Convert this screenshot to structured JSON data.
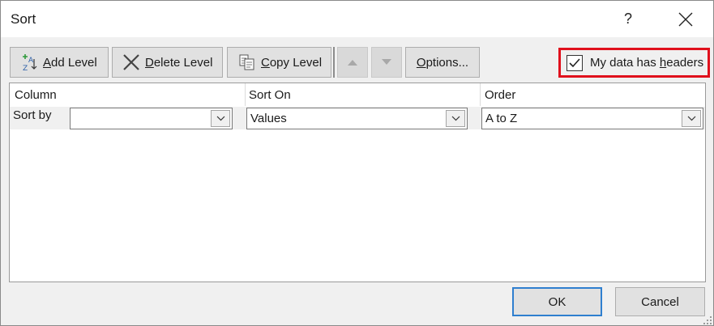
{
  "dialog": {
    "title": "Sort",
    "help_label": "?"
  },
  "toolbar": {
    "add_level": {
      "mnemonic": "A",
      "rest": "dd Level"
    },
    "delete_level": {
      "mnemonic": "D",
      "rest": "elete Level"
    },
    "copy_level": {
      "mnemonic": "C",
      "rest": "opy Level"
    },
    "options": {
      "mnemonic": "O",
      "rest": "ptions..."
    }
  },
  "headers_option": {
    "label_before": "My data has ",
    "mnemonic": "h",
    "label_after": "eaders",
    "checked": true,
    "highlight_color": "#e0101c"
  },
  "grid": {
    "columns": [
      "Column",
      "Sort On",
      "Order"
    ],
    "rows": [
      {
        "label": "Sort by",
        "column_value": "",
        "sort_on": "Values",
        "order": "A to Z"
      }
    ]
  },
  "footer": {
    "ok_label": "OK",
    "cancel_label": "Cancel"
  }
}
